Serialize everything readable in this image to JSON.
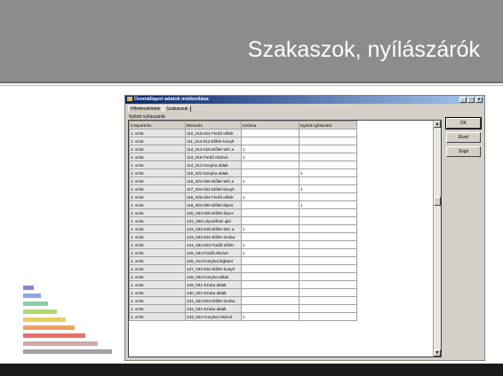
{
  "slide": {
    "title": "Szakaszok, nyílászárók"
  },
  "dialog": {
    "title": "Üzemállapot adatok módosítása",
    "window_buttons": {
      "minimize": "_",
      "maximize": "□",
      "close": "x"
    },
    "tabs": [
      {
        "label": "Hőmérsékletek"
      },
      {
        "label": "Szakaszok",
        "active": true
      }
    ],
    "section_label": "Nyitott nyílászárók",
    "columns": [
      "Csoportnév",
      "Elemnév",
      "Kizárva",
      "Nyitott nyílászáró"
    ],
    "rows": [
      {
        "group": "1. szint",
        "element": "110_015-014 Fürdő előtér",
        "excluded": "",
        "open": ""
      },
      {
        "group": "1. szint",
        "element": "111_014-013 Előtér-konyh",
        "excluded": "",
        "open": ""
      },
      {
        "group": "1. szint",
        "element": "112_014-016 Előtér-WC a",
        "excluded": "1",
        "open": ""
      },
      {
        "group": "1. szint",
        "element": "113_015 Fürdő elszívó",
        "excluded": "1",
        "open": ""
      },
      {
        "group": "1. szint",
        "element": "114_013 Konyha ablak",
        "excluded": "",
        "open": ""
      },
      {
        "group": "1. szint",
        "element": "115_022 Konyha ablak",
        "excluded": "",
        "open": "1"
      },
      {
        "group": "1. szint",
        "element": "116_024-026 Előtér-WC a",
        "excluded": "1",
        "open": ""
      },
      {
        "group": "1. szint",
        "element": "117_024-022 Előtér-konyh",
        "excluded": "",
        "open": "1"
      },
      {
        "group": "1. szint",
        "element": "118_025-024 Fürdő előtér",
        "excluded": "1",
        "open": ""
      },
      {
        "group": "1. szint",
        "element": "119_024-000 Előtér-lépcs",
        "excluded": "",
        "open": "1"
      },
      {
        "group": "1. szint",
        "element": "120_033-000 Előtér-lépcs",
        "excluded": "",
        "open": ""
      },
      {
        "group": "1. szint",
        "element": "121_000 Lépcsőház ajtó",
        "excluded": "",
        "open": ""
      },
      {
        "group": "1. szint",
        "element": "122_033-035 Előtér-WC a",
        "excluded": "1",
        "open": ""
      },
      {
        "group": "1. szint",
        "element": "123_033-031 Előtér-szoba",
        "excluded": "",
        "open": ""
      },
      {
        "group": "1. szint",
        "element": "124_034-033 Fürdő előtér",
        "excluded": "1",
        "open": ""
      },
      {
        "group": "1. szint",
        "element": "125_034 Fürdő elszívó",
        "excluded": "1",
        "open": ""
      },
      {
        "group": "1. szint",
        "element": "126_013 Konyhai légbeer",
        "excluded": "",
        "open": ""
      },
      {
        "group": "1. szint",
        "element": "127_033-032 Előtér-konyh",
        "excluded": "",
        "open": ""
      },
      {
        "group": "1. szint",
        "element": "128_032 Konyha ablak",
        "excluded": "",
        "open": ""
      },
      {
        "group": "1. szint",
        "element": "129_031 Szoba ablak",
        "excluded": "",
        "open": ""
      },
      {
        "group": "1. szint",
        "element": "130_023 Szoba ablak",
        "excluded": "",
        "open": ""
      },
      {
        "group": "1. szint",
        "element": "131_024-023 Előtér-szoba",
        "excluded": "",
        "open": ""
      },
      {
        "group": "1. szint",
        "element": "132_022 Szoba ablak",
        "excluded": "",
        "open": ""
      },
      {
        "group": "1. szint",
        "element": "133_022 Konyhai elszívó",
        "excluded": "1",
        "open": ""
      }
    ],
    "buttons": {
      "ok": "OK",
      "cancel": "Elvet",
      "help": "Súgó"
    },
    "scroll": {
      "up": "▲",
      "down": "▼"
    }
  },
  "colors": {
    "title_band": "#8c8c8c",
    "title_bar_start": "#0a246a",
    "title_bar_end": "#a6caf0",
    "dialog_face": "#d4d0c8",
    "deco_bars": [
      "#9b7fd0",
      "#8fa8e0",
      "#8ad0a8",
      "#b0d870",
      "#e8d060",
      "#f0a060",
      "#e87070",
      "#d0a8a8",
      "#a0a0a0"
    ]
  }
}
